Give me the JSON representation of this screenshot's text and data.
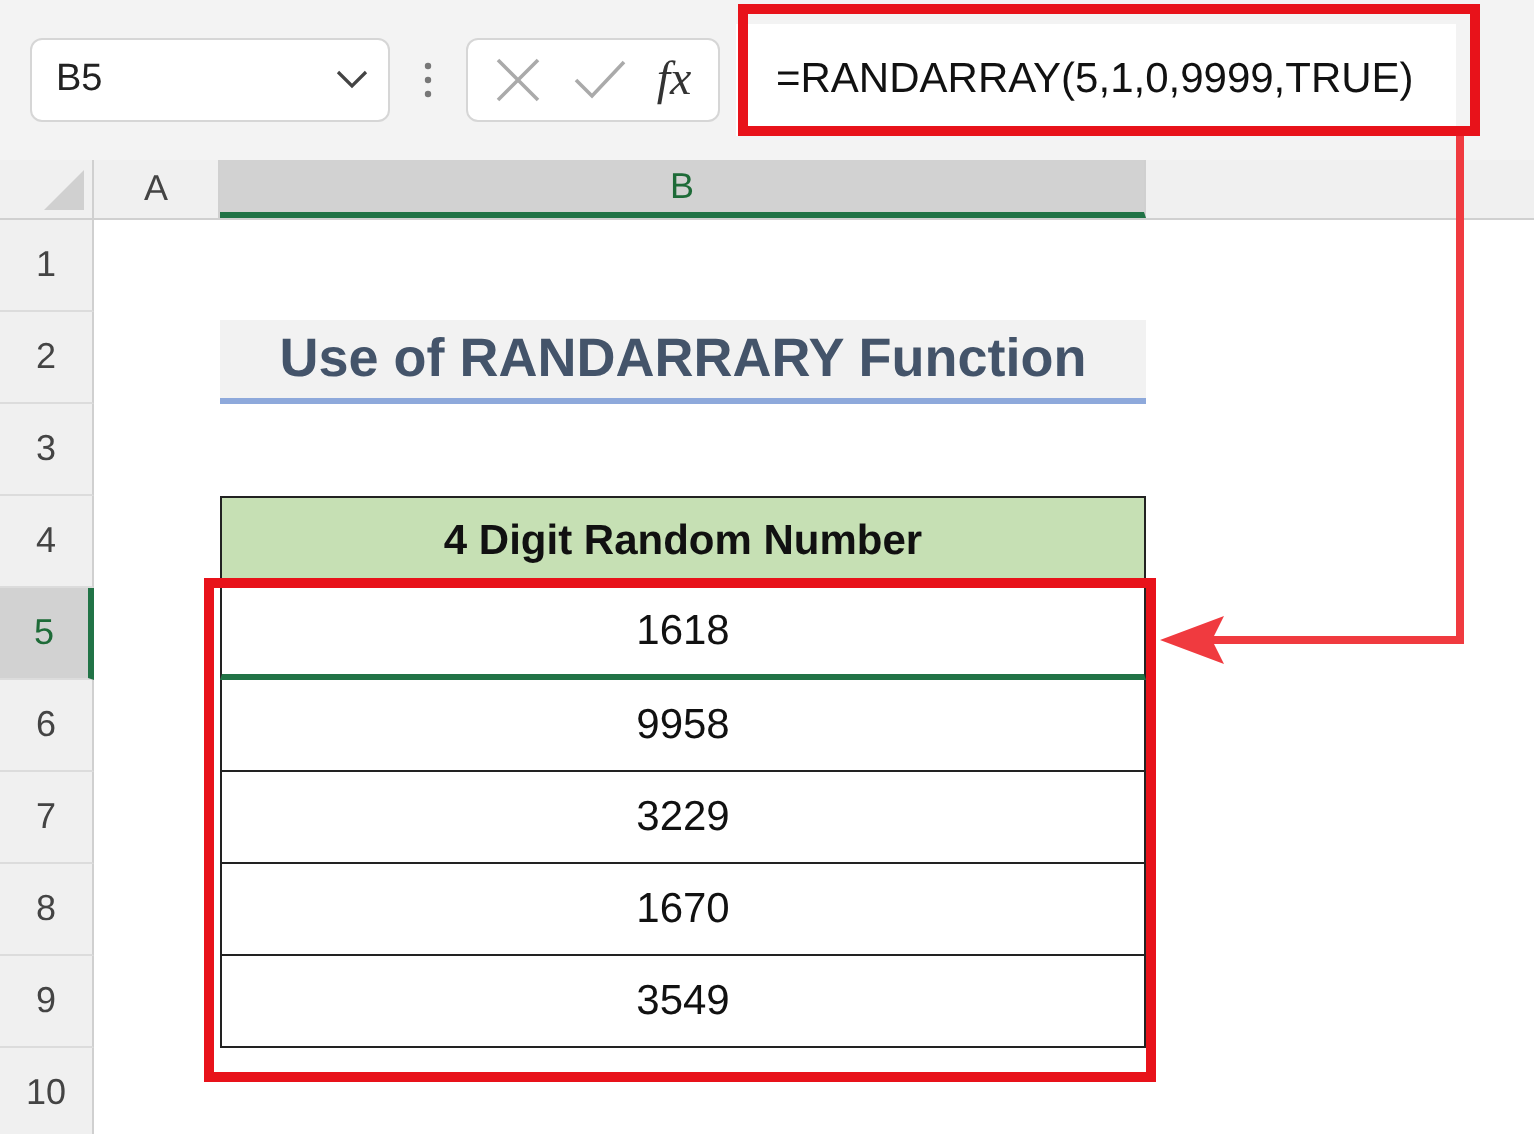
{
  "name_box": {
    "value": "B5"
  },
  "formula_bar": {
    "function_label": "fx",
    "formula": "=RANDARRAY(5,1,0,9999,TRUE)"
  },
  "columns": [
    {
      "label": "A",
      "selected": false
    },
    {
      "label": "B",
      "selected": true
    }
  ],
  "rows": [
    {
      "number": "1",
      "selected": false
    },
    {
      "number": "2",
      "selected": false,
      "cell": {
        "kind": "title",
        "text": "Use of RANDARRARY Function"
      }
    },
    {
      "number": "3",
      "selected": false
    },
    {
      "number": "4",
      "selected": false,
      "cell": {
        "kind": "header",
        "text": "4 Digit Random Number"
      }
    },
    {
      "number": "5",
      "selected": true,
      "cell": {
        "kind": "value",
        "text": "1618"
      }
    },
    {
      "number": "6",
      "selected": false,
      "cell": {
        "kind": "value",
        "text": "9958"
      }
    },
    {
      "number": "7",
      "selected": false,
      "cell": {
        "kind": "value",
        "text": "3229"
      }
    },
    {
      "number": "8",
      "selected": false,
      "cell": {
        "kind": "value",
        "text": "1670"
      }
    },
    {
      "number": "9",
      "selected": false,
      "cell": {
        "kind": "value",
        "text": "3549"
      }
    },
    {
      "number": "10",
      "selected": false
    }
  ]
}
